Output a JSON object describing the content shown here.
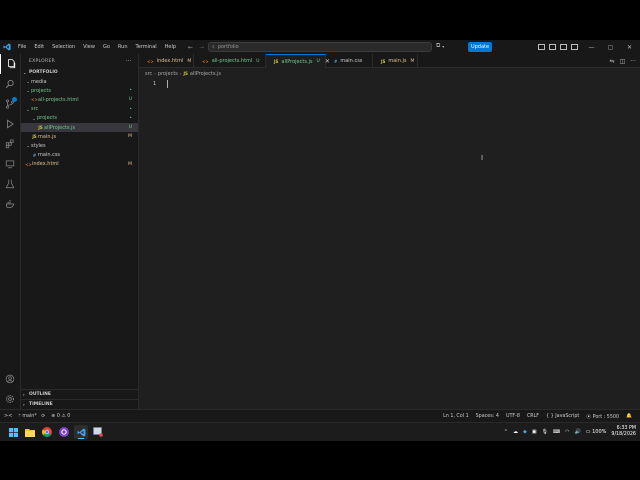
{
  "colors": {
    "accent": "#0078d4",
    "git_untracked": "#73c991",
    "git_modified": "#e2c08d",
    "bg": "#1f1f1f"
  },
  "titlebar": {
    "menu": [
      "File",
      "Edit",
      "Selection",
      "View",
      "Go",
      "Run",
      "Terminal",
      "Help"
    ],
    "search_text": "portfolio",
    "update_label": "Update"
  },
  "activity_bar": {
    "top_icons": [
      "explorer-icon",
      "search-icon",
      "source-control-icon",
      "run-debug-icon",
      "extensions-icon",
      "remote-explorer-icon",
      "testing-icon",
      "docker-icon"
    ],
    "bottom_icons": [
      "account-icon",
      "settings-gear-icon"
    ]
  },
  "explorer": {
    "header": "EXPLORER",
    "root": "PORTFOLIO",
    "items": [
      {
        "label": "media",
        "type": "folder",
        "open": true,
        "status": "",
        "color": "gray"
      },
      {
        "label": "projects",
        "type": "folder",
        "open": true,
        "status": "•",
        "color": "green"
      },
      {
        "label": "all-projects.html",
        "type": "html",
        "status": "U",
        "color": "green"
      },
      {
        "label": "src",
        "type": "folder",
        "open": true,
        "status": "•",
        "color": "green"
      },
      {
        "label": "projects",
        "type": "folder",
        "open": true,
        "status": "•",
        "color": "green"
      },
      {
        "label": "allProjects.js",
        "type": "js",
        "status": "U",
        "color": "green",
        "selected": true
      },
      {
        "label": "main.js",
        "type": "js",
        "status": "M",
        "color": "yellow"
      },
      {
        "label": "styles",
        "type": "folder",
        "open": true,
        "status": "",
        "color": "gray"
      },
      {
        "label": "main.css",
        "type": "css",
        "status": "",
        "color": "gray"
      },
      {
        "label": "index.html",
        "type": "html",
        "status": "M",
        "color": "yellow"
      }
    ],
    "outline_label": "OUTLINE",
    "timeline_label": "TIMELINE"
  },
  "tabs": [
    {
      "label": "index.html",
      "type": "html",
      "status": "M",
      "color": "yellow",
      "active": false
    },
    {
      "label": "all-projects.html",
      "type": "html",
      "status": "U",
      "color": "green",
      "active": false
    },
    {
      "label": "allProjects.js",
      "type": "js",
      "status": "U",
      "color": "green",
      "active": true
    },
    {
      "label": "main.css",
      "type": "css",
      "status": "",
      "color": "gray",
      "active": false
    },
    {
      "label": "main.js",
      "type": "js",
      "status": "M",
      "color": "yellow",
      "active": false
    }
  ],
  "breadcrumb": [
    "src",
    "projects",
    "allProjects.js"
  ],
  "editor": {
    "line_numbers": [
      "1"
    ]
  },
  "statusbar": {
    "remote": "><",
    "branch": "main*",
    "errors": "0",
    "warnings": "0",
    "position": "Ln 1, Col 1",
    "spaces": "Spaces: 4",
    "encoding": "UTF-8",
    "eol": "CRLF",
    "language": "JavaScript",
    "port": "Port : 5500"
  },
  "taskbar": {
    "apps": [
      "windows-start-icon",
      "file-explorer-icon",
      "chrome-icon",
      "obs-icon",
      "vscode-icon",
      "snipping-tool-icon"
    ],
    "battery": "100%",
    "time": "6:33 PM",
    "date": "9/18/2026"
  }
}
